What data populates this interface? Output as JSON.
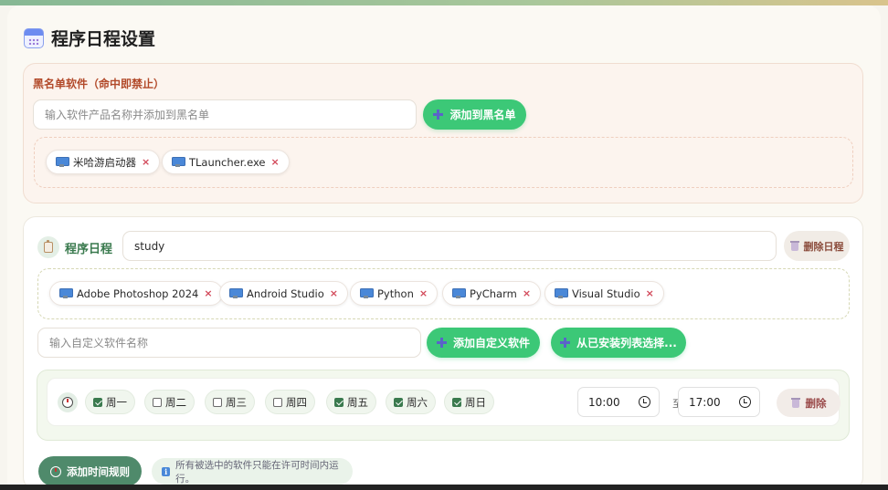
{
  "page": {
    "title": "程序日程设置",
    "title_icon": "calendar-icon"
  },
  "blacklist": {
    "title": "黑名单软件（命中即禁止）",
    "input_placeholder": "输入软件产品名称并添加到黑名单",
    "add_button": "添加到黑名单",
    "items": [
      {
        "label": "米哈游启动器",
        "icon": "monitor-icon"
      },
      {
        "label": "TLauncher.exe",
        "icon": "monitor-icon"
      }
    ]
  },
  "schedule": {
    "title": "程序日程",
    "name_value": "study",
    "delete_button": "删除日程",
    "apps": [
      {
        "label": "Adobe Photoshop 2024"
      },
      {
        "label": "Android Studio"
      },
      {
        "label": "Python"
      },
      {
        "label": "PyCharm"
      },
      {
        "label": "Visual Studio"
      }
    ],
    "custom_input_placeholder": "输入自定义软件名称",
    "add_custom_button": "添加自定义软件",
    "select_installed_button": "从已安装列表选择...",
    "rule": {
      "days": [
        {
          "label": "周一",
          "checked": true
        },
        {
          "label": "周二",
          "checked": false
        },
        {
          "label": "周三",
          "checked": false
        },
        {
          "label": "周四",
          "checked": false
        },
        {
          "label": "周五",
          "checked": true
        },
        {
          "label": "周六",
          "checked": true
        },
        {
          "label": "周日",
          "checked": true
        }
      ],
      "start_time": "10:00",
      "to_label": "至",
      "end_time": "17:00",
      "delete_label": "删除"
    },
    "add_rule_button": "添加时间规则",
    "hint": "所有被选中的软件只能在许可时间内运行。"
  },
  "colors": {
    "accent_green": "#3cc877",
    "danger_red": "#d2495a",
    "title_green": "#3a7a4e"
  }
}
